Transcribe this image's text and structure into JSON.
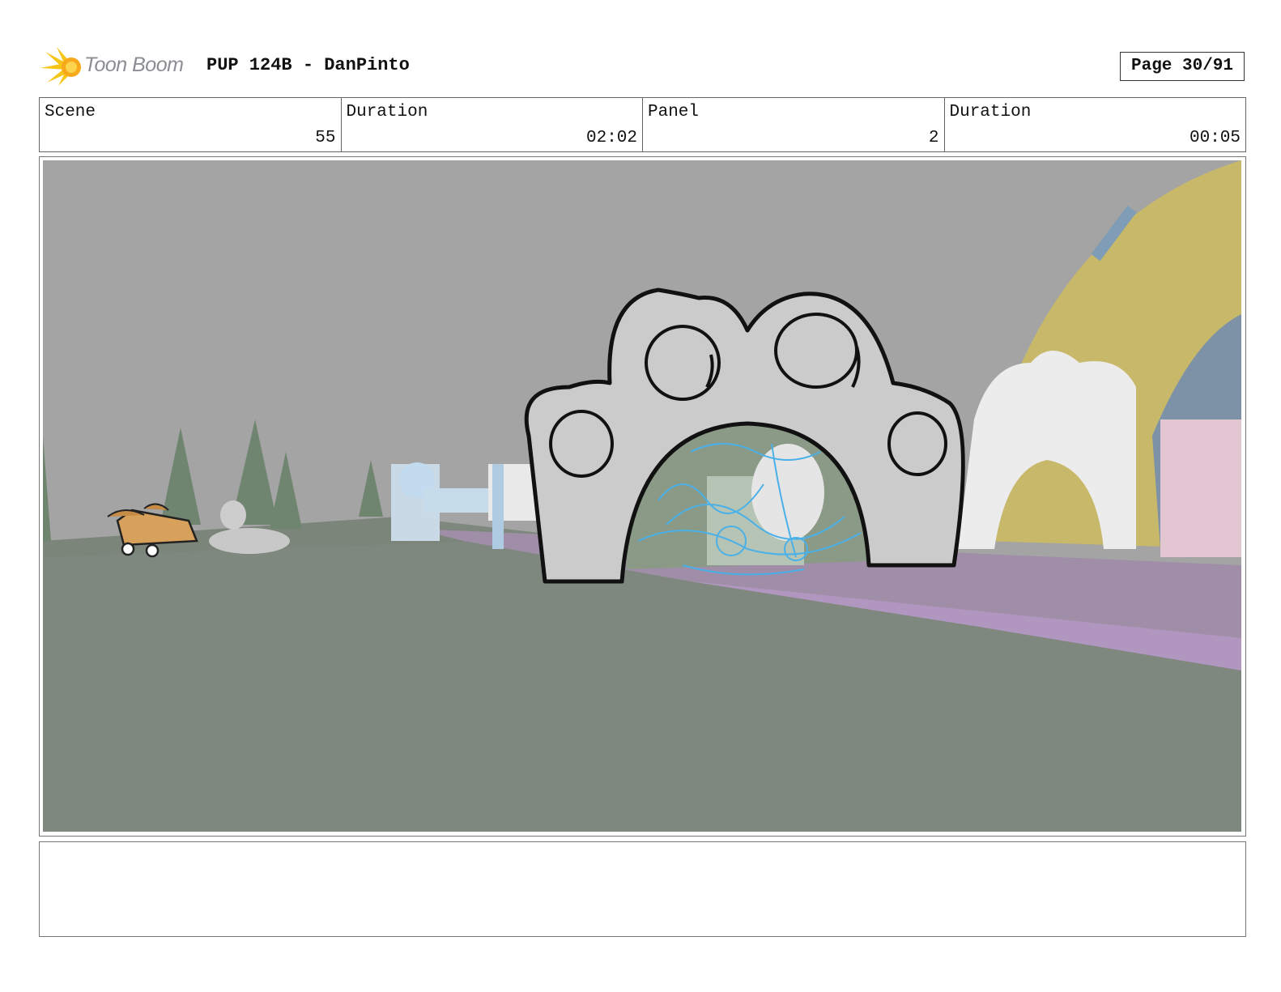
{
  "header": {
    "logo_text": "Toon Boom",
    "title": "PUP 124B - DanPinto",
    "page": "Page 30/91"
  },
  "info": {
    "scene_label": "Scene",
    "scene_value": "55",
    "scene_duration_label": "Duration",
    "scene_duration_value": "02:02",
    "panel_label": "Panel",
    "panel_value": "2",
    "panel_duration_label": "Duration",
    "panel_duration_value": "00:05"
  },
  "notes": {
    "text": ""
  },
  "colors": {
    "sky": "#a4a4a4",
    "ground": "#7f887e",
    "path": "#a08ea8",
    "arch": "#cbcbcb",
    "portal": "#4ab0e8",
    "dome": "#c8b86a",
    "logo_accent": "#f5c518"
  }
}
